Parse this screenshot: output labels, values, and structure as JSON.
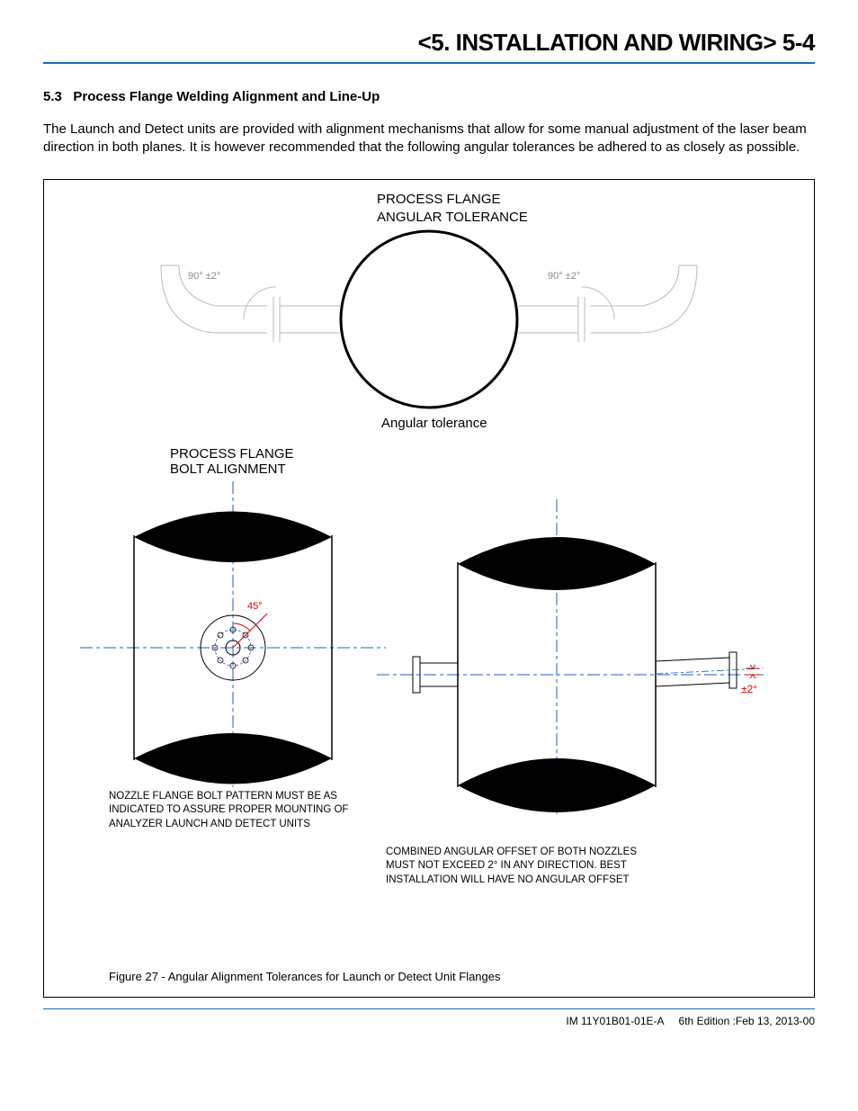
{
  "header": {
    "title": "<5. INSTALLATION AND WIRING>  5-4"
  },
  "section": {
    "number": "5.3",
    "title": "Process Flange Welding Alignment and Line-Up"
  },
  "body": "The Launch and Detect units are provided with alignment mechanisms that allow for some manual adjustment of the laser beam direction in both planes. It is however recommended that the following angular tolerances be adhered to as closely as possible.",
  "diagram": {
    "top_title_line1": "PROCESS FLANGE",
    "top_title_line2": "ANGULAR TOLERANCE",
    "angle_left": "90°  ±2°",
    "angle_right": "90°  ±2°",
    "angular_tolerance_label": "Angular tolerance",
    "mid_title_line1": "PROCESS FLANGE",
    "mid_title_line2": "BOLT ALIGNMENT",
    "bolt_angle": "45°",
    "offset_label": "±2°",
    "note_left_l1": "NOZZLE FLANGE BOLT PATTERN MUST BE AS",
    "note_left_l2": "INDICATED TO ASSURE PROPER MOUNTING OF",
    "note_left_l3": "ANALYZER LAUNCH AND DETECT UNITS",
    "note_right_l1": "COMBINED ANGULAR OFFSET OF BOTH NOZZLES",
    "note_right_l2": "MUST NOT EXCEED 2° IN ANY DIRECTION. BEST",
    "note_right_l3": "INSTALLATION WILL HAVE NO ANGULAR OFFSET"
  },
  "figure_caption": "Figure 27 - Angular Alignment Tolerances for Launch or Detect Unit Flanges",
  "footer": {
    "doc_id": "IM 11Y01B01-01E-A",
    "edition": "6th Edition :Feb 13, 2013-00"
  }
}
